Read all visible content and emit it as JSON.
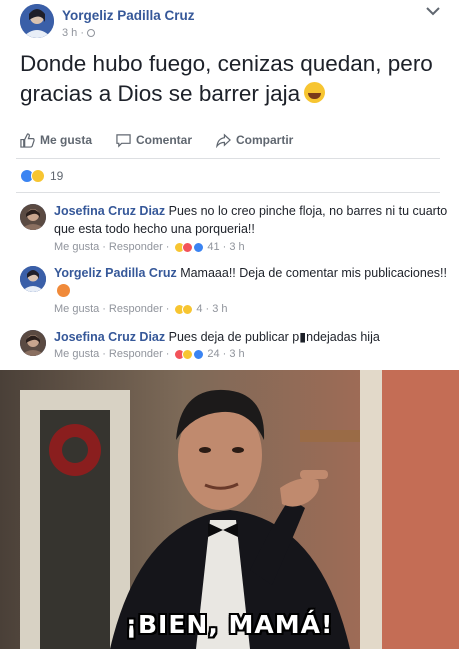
{
  "post": {
    "author": "Yorgeliz Padilla Cruz",
    "time": "3 h ·",
    "text": "Donde hubo fuego, cenizas quedan, pero gracias a Dios se barrer jaja",
    "emoji_icon": "laughing-tears-emoji"
  },
  "actions": {
    "like": "Me gusta",
    "comment": "Comentar",
    "share": "Compartir"
  },
  "reactions": {
    "count": "19",
    "types": [
      "like",
      "haha"
    ]
  },
  "comments": [
    {
      "author": "Josefina Cruz Diaz",
      "text": " Pues no lo creo pinche floja, no barres ni tu cuarto que esta todo hecho una porqueria!!",
      "like": "Me gusta",
      "reply": "Responder",
      "reaction_count": "41",
      "time": "3 h"
    },
    {
      "author": "Yorgeliz Padilla Cruz",
      "text": " Mamaaa!! Deja de comentar mis publicaciones!!",
      "like": "Me gusta",
      "reply": "Responder",
      "reaction_count": "4",
      "time": "3 h"
    },
    {
      "author": "Josefina Cruz Diaz",
      "text": " Pues deja de publicar p▮ndejadas hija",
      "like": "Me gusta",
      "reply": "Responder",
      "reaction_count": "24",
      "time": "3 h"
    }
  ],
  "meme": {
    "caption": "¡BIEN, MAMÁ!"
  },
  "colors": {
    "link": "#365899",
    "meta": "#90949c",
    "like_blue": "#3b84f2",
    "haha_yellow": "#f7c531",
    "love_red": "#f2535a"
  }
}
